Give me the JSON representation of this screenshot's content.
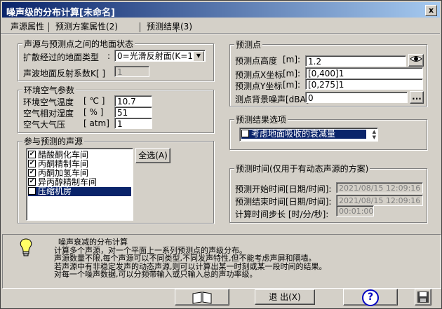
{
  "window": {
    "title": "噪声级的分布计算[未命名]",
    "close": "x"
  },
  "tabs": [
    "声源属性",
    "预测方案属性(2)",
    "预测结果(3)"
  ],
  "ground": {
    "title": "声源与预测点之间的地面状态",
    "type_label": "扩散经过的地面类型",
    "type_value": "0=光滑反射面(K=1)",
    "reflect_label": "声波地面反射系数K[ ]",
    "reflect_value": "1"
  },
  "air": {
    "title": "环境空气参数",
    "temp_label": "环境空气温度",
    "temp_unit": "[ ℃ ]",
    "temp_value": "10.7",
    "hum_label": "空气相对湿度",
    "hum_unit": "[ % ]",
    "hum_value": "51",
    "press_label": "空气大气压",
    "press_unit": "[ atm]",
    "press_value": "1"
  },
  "sources": {
    "title": "参与预测的声源",
    "select_all": "全选(A)",
    "items": [
      "醋酸酮化车间",
      "丙酮精制车间",
      "丙酮加氢车间",
      "异丙醇精制车间",
      "压缩机房"
    ],
    "check": "✔"
  },
  "point": {
    "title": "预测点",
    "height_label": "预测点高度",
    "height_unit": "[m]:",
    "height_value": "1.2",
    "x_label": "预测点X坐标",
    "x_unit": "[m]:",
    "x_value": "[0,400]1",
    "y_label": "预测点Y坐标",
    "y_unit": "[m]:",
    "y_value": "[0,275]1",
    "bg_label": "测点背景噪声[dBA]",
    "bg_value": "0",
    "more": "..."
  },
  "result_options": {
    "title": "预测结果选项",
    "item": "考虑地面吸收的衰减量"
  },
  "time": {
    "title": "预测时间(仅用于有动态声源的方案)",
    "start_label": "预测开始时间[日期/时间]:",
    "start_value": "2021/08/15 12:09:16",
    "end_label": "预测结束时间[日期/时间]:",
    "end_value": "2021/08/15 12:09:16",
    "step_label": "计算时间步长 [时/分/秒]:",
    "step_value": "00:01:00"
  },
  "info": {
    "lines": [
      "噪声衰减的分布计算",
      "计算多个声源，对一个平面上一系列预测点的声级分布。",
      "声源数量不限,每个声源可以不同类型,不同发声特性,但不能考虑声屏和隔墙。",
      "若声源中有非稳定发声的动态声源,则可以计算出某一时刻或某一段时间的结果。",
      "对每一个噪声数据,可以分频带输入或只输入总的声功率级。"
    ]
  },
  "buttons": {
    "exit": "退 出(X)",
    "help": "?"
  },
  "colors": {
    "title_start": "#0a246a",
    "title_end": "#a6caf0",
    "selection": "#0a246a",
    "face": "#d4d0c8"
  }
}
